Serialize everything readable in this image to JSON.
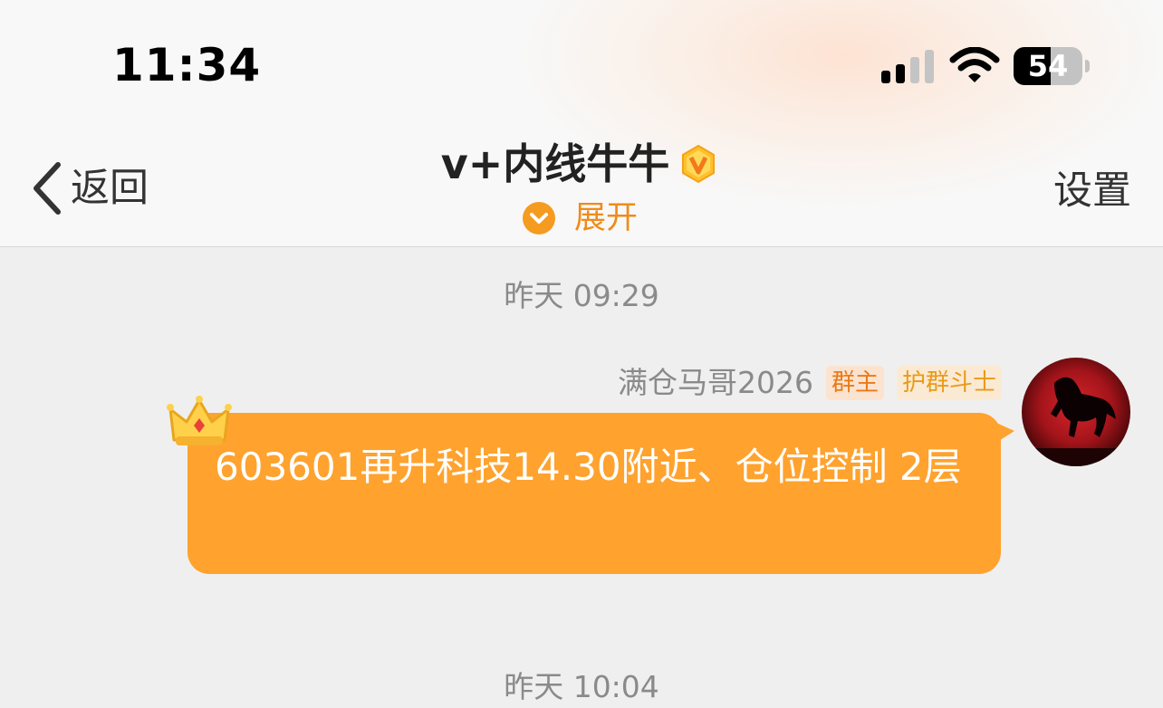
{
  "status_bar": {
    "time": "11:34",
    "battery_level": "54",
    "battery_fraction": 0.54,
    "signal_bars": 2,
    "signal_bars_total": 4
  },
  "nav": {
    "back_label": "返回",
    "title": "v+内线牛牛",
    "expand_label": "展开",
    "settings_label": "设置"
  },
  "messages": {
    "timestamp_1": "昨天 09:29",
    "sender_name": "满仓马哥2026",
    "badge_owner": "群主",
    "badge_guard": "护群斗士",
    "message_text": "603601再升科技14.30附近、仓位控制 2层",
    "timestamp_2": "昨天 10:04"
  },
  "colors": {
    "accent": "#f08b18",
    "bubble": "#ffa22e",
    "background": "#efefef"
  },
  "icons": {
    "back": "chevron-left-icon",
    "verified": "v-badge-icon",
    "expand": "chevron-down-circle-icon",
    "crown": "crown-icon",
    "signal": "cellular-signal-icon",
    "wifi": "wifi-icon",
    "battery": "battery-icon"
  }
}
